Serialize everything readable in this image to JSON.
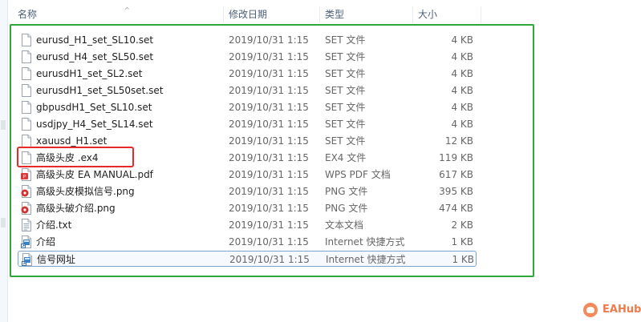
{
  "header": {
    "name_col": "名称",
    "date_col": "修改日期",
    "type_col": "类型",
    "size_col": "大小"
  },
  "files": [
    {
      "name": "eurusd_H1_set_SL10.set",
      "date": "2019/10/31 1:15",
      "type": "SET 文件",
      "size": "4 KB",
      "icon": "blank-file-icon"
    },
    {
      "name": "eurusd_H4_set_SL50.set",
      "date": "2019/10/31 1:15",
      "type": "SET 文件",
      "size": "4 KB",
      "icon": "blank-file-icon"
    },
    {
      "name": "eurusdH1_set_SL2.set",
      "date": "2019/10/31 1:15",
      "type": "SET 文件",
      "size": "4 KB",
      "icon": "blank-file-icon"
    },
    {
      "name": "eurusdH1_set_SL50set.set",
      "date": "2019/10/31 1:15",
      "type": "SET 文件",
      "size": "4 KB",
      "icon": "blank-file-icon"
    },
    {
      "name": "gbpusdH1_Set_SL10.set",
      "date": "2019/10/31 1:15",
      "type": "SET 文件",
      "size": "4 KB",
      "icon": "blank-file-icon"
    },
    {
      "name": "usdjpy_H4_Set_SL14.set",
      "date": "2019/10/31 1:15",
      "type": "SET 文件",
      "size": "4 KB",
      "icon": "blank-file-icon"
    },
    {
      "name": "xauusd_H1.set",
      "date": "2019/10/31 1:15",
      "type": "SET 文件",
      "size": "12 KB",
      "icon": "blank-file-icon"
    },
    {
      "name": "高级头皮 .ex4",
      "date": "2019/10/31 1:15",
      "type": "EX4 文件",
      "size": "119 KB",
      "icon": "blank-file-icon"
    },
    {
      "name": "高级头皮 EA MANUAL.pdf",
      "date": "2019/10/31 1:15",
      "type": "WPS PDF 文档",
      "size": "617 KB",
      "icon": "pdf-file-icon"
    },
    {
      "name": "高级头皮模拟信号.png",
      "date": "2019/10/31 1:15",
      "type": "PNG 文件",
      "size": "395 KB",
      "icon": "png-file-icon"
    },
    {
      "name": "高级头破介绍.png",
      "date": "2019/10/31 1:15",
      "type": "PNG 文件",
      "size": "474 KB",
      "icon": "png-file-icon"
    },
    {
      "name": "介绍.txt",
      "date": "2019/10/31 1:15",
      "type": "文本文档",
      "size": "2 KB",
      "icon": "text-file-icon"
    },
    {
      "name": "介绍",
      "date": "2019/10/31 1:15",
      "type": "Internet 快捷方式",
      "size": "1 KB",
      "icon": "shortcut-file-icon"
    },
    {
      "name": "信号网址",
      "date": "2019/10/31 1:15",
      "type": "Internet 快捷方式",
      "size": "1 KB",
      "icon": "shortcut-file-icon"
    }
  ],
  "selected_index": 13,
  "watermark": {
    "text": "EAHub"
  },
  "colors": {
    "frame": "#2ea83a",
    "highlight": "#e62929",
    "header_text": "#4c607a",
    "watermark": "#f07a4a"
  }
}
